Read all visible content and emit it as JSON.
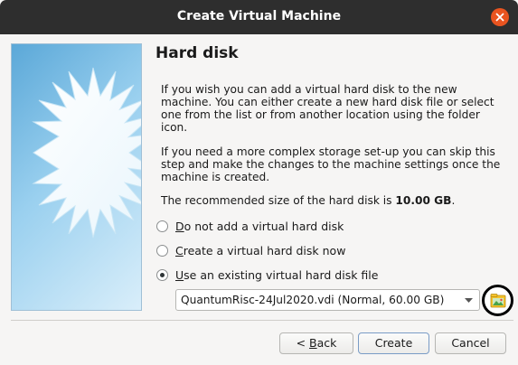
{
  "window": {
    "title": "Create Virtual Machine"
  },
  "page": {
    "title": "Hard disk",
    "paragraph1": "If you wish you can add a virtual hard disk to the new machine. You can either create a new hard disk file or select one from the list or from another location using the folder icon.",
    "paragraph2": "If you need a more complex storage set-up you can skip this step and make the changes to the machine settings once the machine is created.",
    "recommended_prefix": "The recommended size of the hard disk is ",
    "recommended_size": "10.00 GB",
    "recommended_suffix": "."
  },
  "options": [
    {
      "mnemonic": "D",
      "rest": "o not add a virtual hard disk",
      "checked": false
    },
    {
      "mnemonic": "C",
      "rest": "reate a virtual hard disk now",
      "checked": false
    },
    {
      "mnemonic": "U",
      "rest": "se an existing virtual hard disk file",
      "checked": true
    }
  ],
  "disk_select": {
    "value": "QuantumRisc-24Jul2020.vdi (Normal, 60.00 GB)"
  },
  "buttons": {
    "back_prefix": "< ",
    "back_mnemonic": "B",
    "back_rest": "ack",
    "create": "Create",
    "cancel": "Cancel"
  },
  "icons": {
    "close": "close-icon",
    "folder": "folder-open-icon",
    "dropdown": "chevron-down-icon",
    "wizard": "starburst-image"
  },
  "colors": {
    "titlebar": "#2e2e2e",
    "close": "#e95420",
    "accent": "#7a9cc6"
  }
}
